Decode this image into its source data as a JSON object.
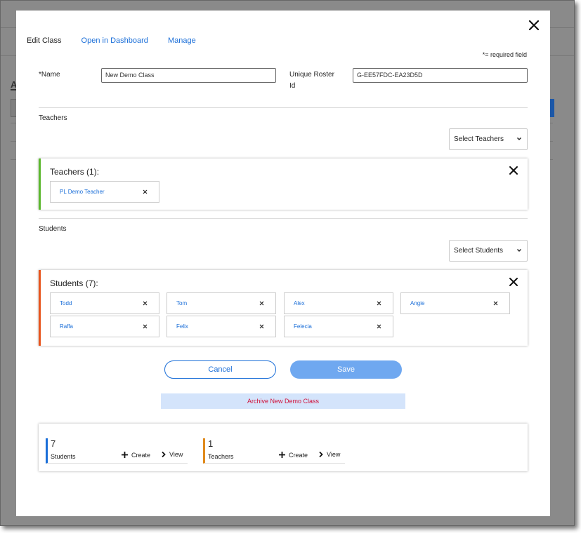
{
  "tabs": {
    "edit_class": "Edit Class",
    "open_dashboard": "Open in Dashboard",
    "manage": "Manage"
  },
  "required_note": "*= required field",
  "name_field": {
    "label": "*Name",
    "value": "New Demo Class"
  },
  "roster_field": {
    "label_line1": "Unique Roster",
    "label_line2": "Id",
    "value": "G-EE57FDC-EA23D5D"
  },
  "teachers_section": {
    "title": "Teachers",
    "select_label": "Select Teachers",
    "group_title": "Teachers (1):",
    "accent": "#5cb82e",
    "members": [
      "PL Demo Teacher"
    ]
  },
  "students_section": {
    "title": "Students",
    "select_label": "Select Students",
    "group_title": "Students (7):",
    "accent": "#e8541c",
    "members": [
      "Todd",
      "Tom",
      "Alex",
      "Angie",
      "Raffa",
      "Felix",
      "Felecia"
    ]
  },
  "buttons": {
    "cancel": "Cancel",
    "save": "Save"
  },
  "archive_label": "Archive New Demo Class",
  "stats": [
    {
      "count": "7",
      "label": "Students",
      "accent": "#1a6ed8",
      "create": "Create",
      "view": "View"
    },
    {
      "count": "1",
      "label": "Teachers",
      "accent": "#e08a1c",
      "create": "Create",
      "view": "View"
    }
  ],
  "background": {
    "fragment_letter": "A"
  },
  "icons": {
    "close": "close-icon",
    "chip_remove": "close-icon",
    "dropdown": "chevron-down-icon",
    "create": "plus-icon",
    "view": "chevron-right-icon"
  }
}
